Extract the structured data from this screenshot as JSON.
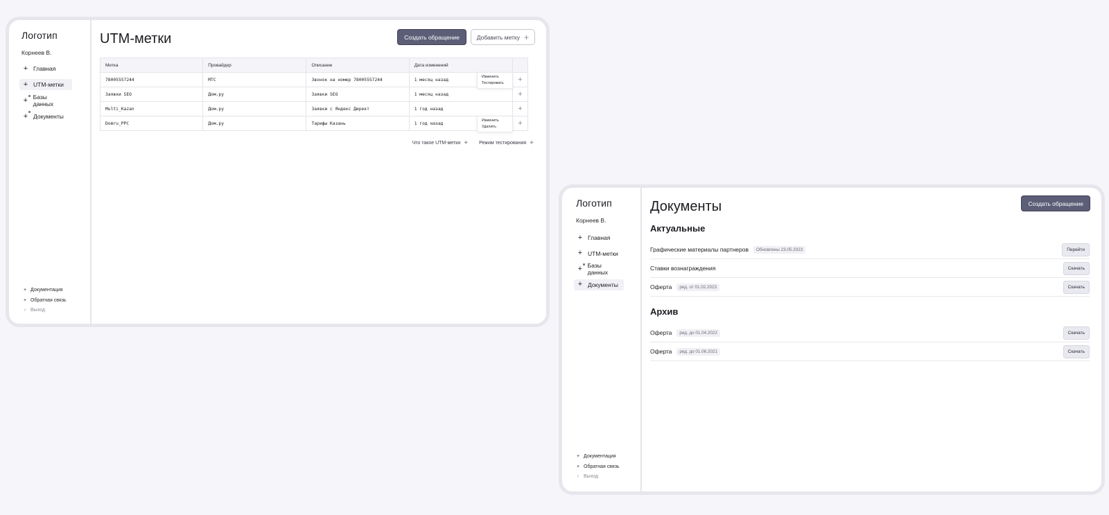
{
  "utm_screen": {
    "sidebar": {
      "logo": "Логотип",
      "user": "Корнеев В.",
      "items": [
        {
          "label": "Главная",
          "icon": "+"
        },
        {
          "label": "UTM-метки",
          "icon": "+"
        },
        {
          "label": "Базы данных",
          "icon": "+"
        },
        {
          "label": "Документы",
          "icon": "+"
        }
      ],
      "active_item": "UTM-метки",
      "footer": [
        {
          "label": "Документация",
          "icon": "+"
        },
        {
          "label": "Обратная связь",
          "icon": "+"
        },
        {
          "label": "Выход",
          "icon": "‹"
        }
      ]
    },
    "title": "UTM-метки",
    "actions": {
      "create": "Создать обращение",
      "add_tag": "Добавить метку"
    },
    "table": {
      "columns": [
        "Метка",
        "Провайдер",
        "Описание",
        "Дата изменений"
      ],
      "rows": [
        {
          "tag": "78005557244",
          "provider": "МТС",
          "description": "Звонок на номер 78005557244",
          "date": "1 месяц назад",
          "menu": [
            "Изменить",
            "Тестировать"
          ]
        },
        {
          "tag": "Заявки SEO",
          "provider": "Дом.ру",
          "description": "Заявки SEO",
          "date": "1 месяц назад",
          "menu": []
        },
        {
          "tag": "Multi_Kazan",
          "provider": "Дом.ру",
          "description": "Заявки с Яндекс Директ",
          "date": "1 год назад",
          "menu": []
        },
        {
          "tag": "Domru_PPC",
          "provider": "Дом.ру",
          "description": "Тарифы Казань",
          "date": "1 год назад",
          "menu": [
            "Изменить",
            "Удалить"
          ]
        }
      ]
    },
    "links": {
      "what_is": "Что такое UTM-метки",
      "test_mode": "Режим тестирования"
    }
  },
  "docs_screen": {
    "sidebar": {
      "logo": "Логотип",
      "user": "Корнеев В.",
      "items": [
        {
          "label": "Главная",
          "icon": "+"
        },
        {
          "label": "UTM-метки",
          "icon": "+"
        },
        {
          "label": "Базы данных",
          "icon": "+"
        },
        {
          "label": "Документы",
          "icon": "+"
        }
      ],
      "active_item": "Документы",
      "footer": [
        {
          "label": "Документация",
          "icon": "+"
        },
        {
          "label": "Обратная связь",
          "icon": "+"
        },
        {
          "label": "Выход",
          "icon": "‹"
        }
      ]
    },
    "title": "Документы",
    "actions": {
      "create": "Создать обращение"
    },
    "sections": [
      {
        "title": "Актуальные",
        "docs": [
          {
            "name": "Графические материалы партнеров",
            "badge": "Обновлены 23.05.2023",
            "action": "Перейти"
          },
          {
            "name": "Ставки вознаграждения",
            "badge": "",
            "action": "Скачать"
          },
          {
            "name": "Оферта",
            "badge": "ред. от 01.02.2023",
            "action": "Скачать"
          }
        ]
      },
      {
        "title": "Архив",
        "docs": [
          {
            "name": "Оферта",
            "badge": "ред. до 01.04.2022",
            "action": "Скачать"
          },
          {
            "name": "Оферта",
            "badge": "ред. до 01.06.2021",
            "action": "Скачать"
          }
        ]
      }
    ]
  },
  "colors": {
    "primary_button": "#5c5e77",
    "page_background": "#f6f6fa",
    "frame_border": "#e6e6ec"
  }
}
